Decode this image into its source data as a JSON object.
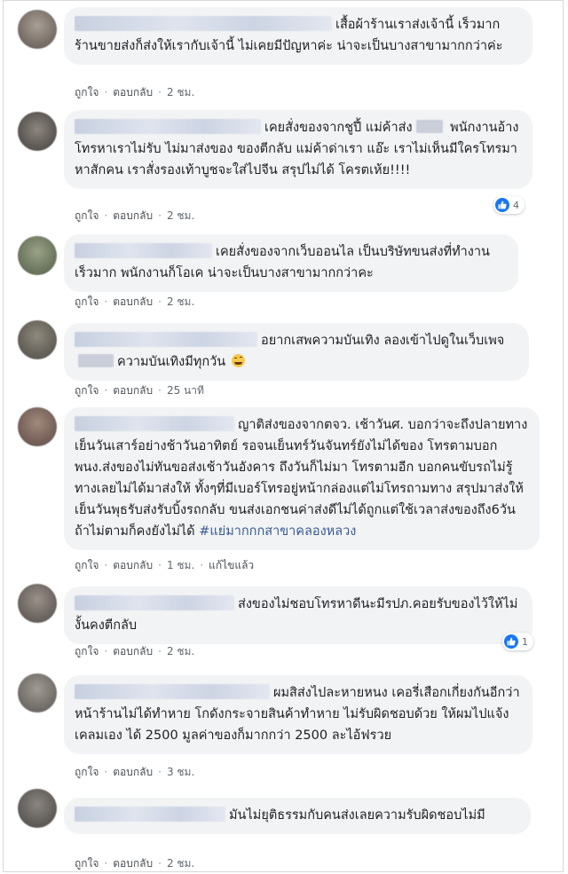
{
  "comments": [
    {
      "text": "เสื้อผ้าร้านเราส่งเจ้านี้ เร็วมาก ร้านขายส่งก็ส่งให้เรากับเจ้านี้ ไม่เคยมีปัญหาค่ะ น่าจะเป็นบางสาขามากกว่าค่ะ",
      "like": "ถูกใจ",
      "reply": "ตอบกลับ",
      "time": "2 ชม."
    },
    {
      "text_before": "เคยสั่งของจากชูปี้ แม่ค้าส่ง",
      "text": "พนักงานอ้างโทรหาเราไม่รับ ไม่มาส่งของ ของตีกลับ แม่ค้าด่าเรา แอ๊ะ เราไม่เห็นมีใครโทรมาหาสักคน เราสั่งรองเท้าบูชจะใส่ไปจีน สรุปไม่ได้ โครตเห้ย!!!!",
      "like": "ถูกใจ",
      "reply": "ตอบกลับ",
      "time": "2 ชม.",
      "reactions": "4"
    },
    {
      "text": "เคยสั่งของจากเว็บออนไล เป็นบริษัทขนส่งที่ทำงานเร็วมาก พนักงานก็โอเค น่าจะเป็นบางสาขามากกว่าคะ",
      "like": "ถูกใจ",
      "reply": "ตอบกลับ",
      "time": "2 ชม."
    },
    {
      "text_before": "อยากเสพความบันเทิง ลองเข้าไปดูในเว็บเพจ",
      "text": "ความบันเทิงมีทุกวัน",
      "like": "ถูกใจ",
      "reply": "ตอบกลับ",
      "time": "25 นาที"
    },
    {
      "text": "ญาติส่งของจากตจว. เช้าวันศ. บอกว่าจะถึงปลายทางเย็นวันเสาร์อย่างช้าวันอาทิตย์ รอจนเย็นทร์วันจันทร์ยังไม่ได้ของ โทรตามบอกพนง.ส่งของไม่ทันขอส่งเช้าวันอังคาร ถึงวันก็ไม่มา โทรตามอีก บอกคนขับรถไม่รู้ทางเลยไม่ได้มาส่งให้ ทั้งๆที่มีเบอร์โทรอยู่หน้ากล่องแต่ไม่โทรถามทาง สรุปมาส่งให้เย็นวันพุธรับส่งรับบิ้งรถกลับ ขนส่งเอกชนค่าส่งดีไม่ได้ถูกแต่ใช้เวลาส่งของถึง6วันถ้าไม่ตามก็คงยังไม่ได้",
      "hashtag": "#แย่มากกกสาขาคลองหลวง",
      "like": "ถูกใจ",
      "reply": "ตอบกลับ",
      "time": "1 ชม.",
      "edited": "แก้ไขแล้ว"
    },
    {
      "text": "ส่งของไม่ชอบโทรหาดีนะมีรปภ.คอยรับของไว้ให้ไม่งั้นคงตีกลับ",
      "like": "ถูกใจ",
      "reply": "ตอบกลับ",
      "time": "2 ชม.",
      "reactions": "1"
    },
    {
      "text": "ผมสิส่งไปละหายหนง เคอรี่เสือกเกี่ยงกันอีกว่าหน้าร้านไม่ได้ทำหาย โกดังกระจายสินค้าทำหาย ไม่รับผิดชอบด้วย ให้ผมไปแจ้งเคลมเอง ได้ 2500 มูลค่าของก็มากกว่า 2500 ละไอ้ฟรวย",
      "like": "ถูกใจ",
      "reply": "ตอบกลับ",
      "time": "3 ชม."
    },
    {
      "text": "มันไม่ยุติธรรมกับคนส่งเลยความรับผิดชอบไม่มี",
      "like": "ถูกใจ",
      "reply": "ตอบกลับ",
      "time": "2 ชม."
    }
  ],
  "colors": {
    "bubble": "#f2f3f5",
    "link": "#4b4f56",
    "hashtag": "#385898",
    "like_blue": "#1877f2"
  }
}
